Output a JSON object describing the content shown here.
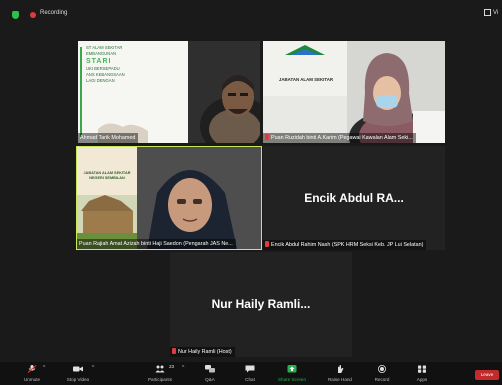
{
  "topbar": {
    "recording_label": "Recording",
    "view_label": "Vi"
  },
  "tiles": {
    "ahmad": {
      "name": "Ahmad Tarik Mohamed"
    },
    "ruzi": {
      "name": "Puan Ruzidah binti A.Karim (Pegawai Kawalan Alam Seki..."
    },
    "rajiah": {
      "name": "Puan Rajiah Amat Azizah binti Haji Saedon (Pengarah JAS Ne..."
    },
    "abdul": {
      "display": "Encik Abdul RA...",
      "name": "Encik Abdul Rahim Nash (SPK HRM Seksi Keb. JP Lui Selatan)"
    },
    "nur": {
      "display": "Nur Haily Ramli...",
      "name": "Nur Haily Ramli (Host)"
    }
  },
  "slide": {
    "line1": "ST ALAM SEKITAR",
    "line2": "EMBANGUNAN",
    "line3": "STARI",
    "line4": "UKI BERSEPADU",
    "line5": "ANS KEBANGSAAN",
    "line6": "LAGI DENGAN"
  },
  "banner_jas": "JABATAN ALAM SEKITAR",
  "banner_ns": {
    "line1": "JABATAN ALAM SEKITAR",
    "line2": "NEGERI SEMBILAN"
  },
  "toolbar": {
    "unmute": "Unmute",
    "stop_video": "Stop Video",
    "participants": "Participants",
    "participants_count": "23",
    "qa": "Q&A",
    "chat": "Chat",
    "share_screen": "Share Screen",
    "raise_hand": "Raise Hand",
    "record": "Record",
    "apps": "Apps",
    "leave": "Leave"
  },
  "colors": {
    "share_green": "#22b24c",
    "leave_red": "#c12b2b",
    "active_border": "#c8e85a",
    "muted_red": "#e23a3a"
  }
}
